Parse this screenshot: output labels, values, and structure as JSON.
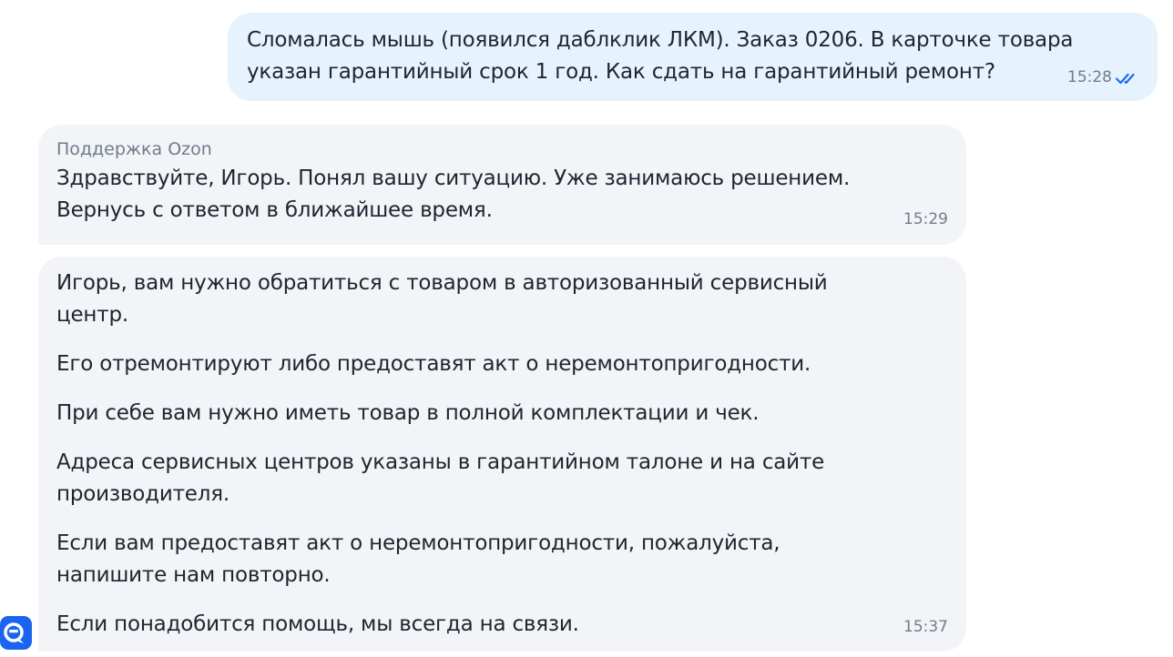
{
  "chat": {
    "outgoing": {
      "lines": [
        "Сломалась мышь (появился даблклик ЛКМ). Заказ 0206. В карточке товара",
        "указан гарантийный срок 1 год. Как сдать на гарантийный ремонт?"
      ],
      "time": "15:28",
      "status_icon": "double-check-icon",
      "status_color": "#1a6cf0"
    },
    "incoming_first": {
      "sender": "Поддержка Ozon",
      "lines": [
        "Здравствуйте, Игорь. Понял вашу ситуацию. Уже занимаюсь решением.",
        "Вернусь с ответом в ближайшее время."
      ],
      "time": "15:29"
    },
    "incoming_second": {
      "paragraphs": [
        [
          "Игорь, вам нужно обратиться с товаром в авторизованный сервисный",
          "центр."
        ],
        [
          "Его отремонтируют либо предоставят акт о неремонтопригодности."
        ],
        [
          "При себе вам нужно иметь товар в полной комплектации и чек."
        ],
        [
          "Адреса сервисных центров указаны в гарантийном талоне и на сайте",
          "производителя."
        ],
        [
          "Если вам предоставят акт о неремонтопригодности, пожалуйста,",
          "напишите нам повторно."
        ],
        [
          "Если понадобится помощь, мы всегда на связи."
        ]
      ],
      "time": "15:37"
    },
    "avatar": {
      "icon": "ozon-support-avatar-icon",
      "color": "#1a64f0"
    }
  },
  "colors": {
    "outgoing_bubble": "#e6f3fd",
    "incoming_bubble": "#f2f4f7",
    "meta_text": "#6f7c8e",
    "main_text": "#1f2430"
  }
}
